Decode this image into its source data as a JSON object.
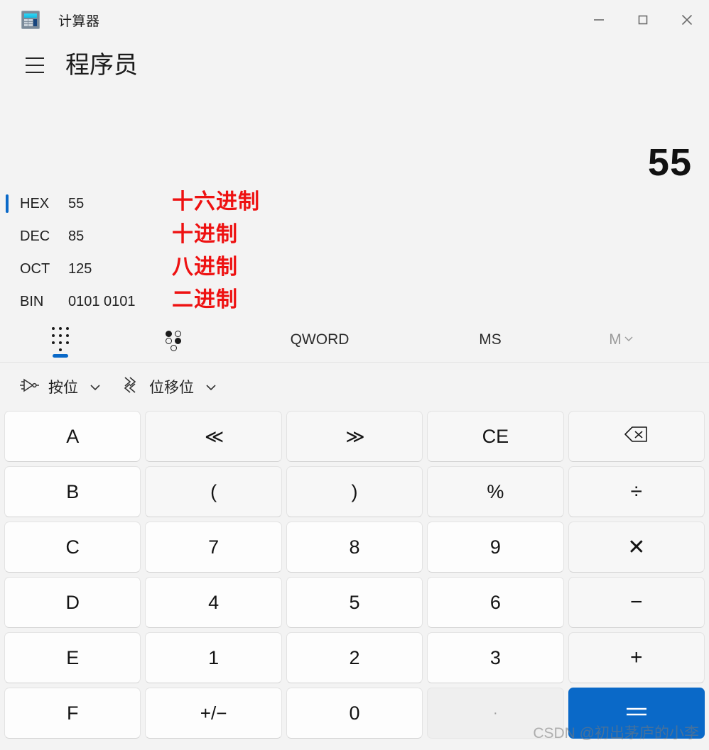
{
  "window": {
    "app_title": "计算器",
    "app_icon": "calculator-icon",
    "controls": {
      "minimize": "—",
      "maximize": "□",
      "close": "✕"
    }
  },
  "mode": {
    "menu_icon": "hamburger-menu-icon",
    "title": "程序员"
  },
  "display": {
    "value": "55"
  },
  "radix": {
    "selected": "HEX",
    "rows": [
      {
        "label": "HEX",
        "value": "55",
        "note": "十六进制",
        "selected": true
      },
      {
        "label": "DEC",
        "value": "85",
        "note": "十进制",
        "selected": false
      },
      {
        "label": "OCT",
        "value": "125",
        "note": "八进制",
        "selected": false
      },
      {
        "label": "BIN",
        "value": "0101 0101",
        "note": "二进制",
        "selected": false
      }
    ]
  },
  "tabs": [
    {
      "name": "keypad",
      "icon": "keypad-dots-icon",
      "label": "",
      "active": true,
      "disabled": false
    },
    {
      "name": "bit-toggle",
      "icon": "bit-toggle-icon",
      "label": "",
      "active": false,
      "disabled": false
    },
    {
      "name": "word-size",
      "icon": "",
      "label": "QWORD",
      "active": false,
      "disabled": false
    },
    {
      "name": "memory-store",
      "icon": "",
      "label": "MS",
      "active": false,
      "disabled": false
    },
    {
      "name": "memory-menu",
      "icon": "chevron-down-icon",
      "label": "M",
      "active": false,
      "disabled": true
    }
  ],
  "operator_bar": [
    {
      "name": "bitwise",
      "icon": "not-gate-icon",
      "label": "按位",
      "chevron": "chevron-down-icon"
    },
    {
      "name": "bit-shift",
      "icon": "bit-shift-icon",
      "label": "位移位",
      "chevron": "chevron-down-icon"
    }
  ],
  "keypad": {
    "rows": [
      [
        {
          "name": "hex-a",
          "label": "A",
          "style": "hex"
        },
        {
          "name": "shift-left",
          "label": "≪",
          "style": "dim"
        },
        {
          "name": "shift-right",
          "label": "≫",
          "style": "dim"
        },
        {
          "name": "clear-entry",
          "label": "CE",
          "style": "dim"
        },
        {
          "name": "backspace",
          "label": "",
          "style": "dim",
          "icon": "backspace-icon"
        }
      ],
      [
        {
          "name": "hex-b",
          "label": "B",
          "style": "hex"
        },
        {
          "name": "paren-open",
          "label": "(",
          "style": "dim"
        },
        {
          "name": "paren-close",
          "label": ")",
          "style": "dim"
        },
        {
          "name": "modulo",
          "label": "%",
          "style": "dim"
        },
        {
          "name": "divide",
          "label": "÷",
          "style": "dim"
        }
      ],
      [
        {
          "name": "hex-c",
          "label": "C",
          "style": "hex"
        },
        {
          "name": "digit-7",
          "label": "7",
          "style": "num"
        },
        {
          "name": "digit-8",
          "label": "8",
          "style": "num"
        },
        {
          "name": "digit-9",
          "label": "9",
          "style": "num"
        },
        {
          "name": "multiply",
          "label": "✕",
          "style": "dim"
        }
      ],
      [
        {
          "name": "hex-d",
          "label": "D",
          "style": "hex"
        },
        {
          "name": "digit-4",
          "label": "4",
          "style": "num"
        },
        {
          "name": "digit-5",
          "label": "5",
          "style": "num"
        },
        {
          "name": "digit-6",
          "label": "6",
          "style": "num"
        },
        {
          "name": "subtract",
          "label": "−",
          "style": "dim"
        }
      ],
      [
        {
          "name": "hex-e",
          "label": "E",
          "style": "hex"
        },
        {
          "name": "digit-1",
          "label": "1",
          "style": "num"
        },
        {
          "name": "digit-2",
          "label": "2",
          "style": "num"
        },
        {
          "name": "digit-3",
          "label": "3",
          "style": "num"
        },
        {
          "name": "add",
          "label": "+",
          "style": "dim"
        }
      ],
      [
        {
          "name": "hex-f",
          "label": "F",
          "style": "hex"
        },
        {
          "name": "plus-minus",
          "label": "+/−",
          "style": "num"
        },
        {
          "name": "digit-0",
          "label": "0",
          "style": "num"
        },
        {
          "name": "decimal-point",
          "label": "·",
          "style": "disabled"
        },
        {
          "name": "equals",
          "label": "=",
          "style": "equals"
        }
      ]
    ]
  },
  "watermark": "CSDN @初出茅庐的小李",
  "colors": {
    "accent": "#0a69c8",
    "annotation": "#ee1111",
    "background": "#f3f3f3",
    "key_face": "#fdfdfd"
  }
}
